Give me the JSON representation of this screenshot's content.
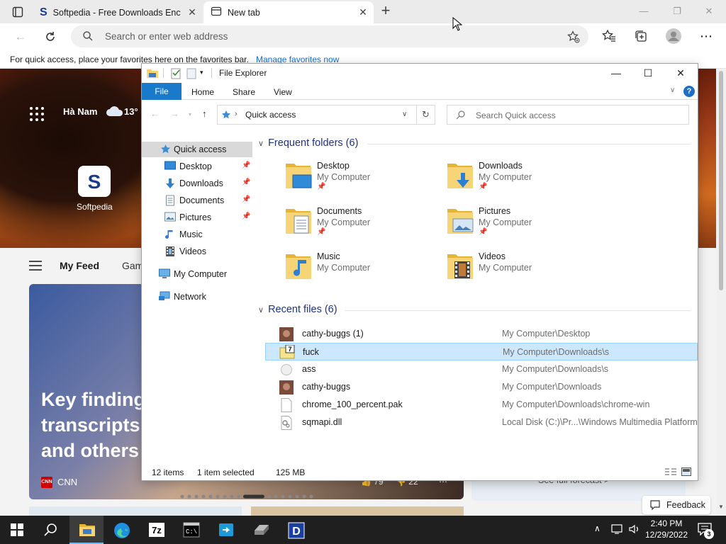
{
  "browser": {
    "tabs": [
      {
        "title": "Softpedia - Free Downloads Enc"
      },
      {
        "title": "New tab"
      }
    ],
    "address_placeholder": "Search or enter web address",
    "favbar_prompt": "For quick access, place your favorites here on the favorites bar.",
    "favbar_link": "Manage favorites now"
  },
  "newtab": {
    "location": "Hà Nam",
    "temperature": "13°",
    "tile_label": "Softpedia",
    "feed_tab": "My Feed",
    "feed_tab2": "Gam",
    "headline_lines": [
      "Key finding",
      "transcripts,",
      "and others"
    ],
    "source": "CNN",
    "source_logo": "CNN",
    "likes": "79",
    "dislikes": "22",
    "forecast_link": "See full forecast >",
    "feedback": "Feedback"
  },
  "explorer": {
    "title": "File Explorer",
    "ribbon_tabs": [
      "File",
      "Home",
      "Share",
      "View"
    ],
    "address_location": "Quick access",
    "search_placeholder": "Search Quick access",
    "nav": [
      {
        "label": "Quick access",
        "icon": "star-icon"
      },
      {
        "label": "Desktop",
        "icon": "desktop-icon",
        "pinned": true
      },
      {
        "label": "Downloads",
        "icon": "downloads-icon",
        "pinned": true
      },
      {
        "label": "Documents",
        "icon": "documents-icon",
        "pinned": true
      },
      {
        "label": "Pictures",
        "icon": "pictures-icon",
        "pinned": true
      },
      {
        "label": "Music",
        "icon": "music-icon"
      },
      {
        "label": "Videos",
        "icon": "videos-icon"
      },
      {
        "label": "My Computer",
        "icon": "computer-icon"
      },
      {
        "label": "Network",
        "icon": "network-icon"
      }
    ],
    "frequent_header": "Frequent folders (6)",
    "frequent": [
      {
        "name": "Desktop",
        "location": "My Computer",
        "overlay": "desktop",
        "pinned": true
      },
      {
        "name": "Downloads",
        "location": "My Computer",
        "overlay": "downloads",
        "pinned": true
      },
      {
        "name": "Documents",
        "location": "My Computer",
        "overlay": "documents",
        "pinned": true
      },
      {
        "name": "Pictures",
        "location": "My Computer",
        "overlay": "pictures",
        "pinned": true
      },
      {
        "name": "Music",
        "location": "My Computer",
        "overlay": "music",
        "pinned": false
      },
      {
        "name": "Videos",
        "location": "My Computer",
        "overlay": "videos",
        "pinned": false
      }
    ],
    "recent_header": "Recent files (6)",
    "recent": [
      {
        "name": "cathy-buggs (1)",
        "path": "My Computer\\Desktop",
        "icon": "photo-icon"
      },
      {
        "name": "fuck",
        "path": "My Computer\\Downloads\\s",
        "icon": "archive-7z-icon",
        "selected": true
      },
      {
        "name": "ass",
        "path": "My Computer\\Downloads\\s",
        "icon": "generic-file-icon"
      },
      {
        "name": "cathy-buggs",
        "path": "My Computer\\Downloads",
        "icon": "photo-icon"
      },
      {
        "name": "chrome_100_percent.pak",
        "path": "My Computer\\Downloads\\chrome-win",
        "icon": "blank-file-icon"
      },
      {
        "name": "sqmapi.dll",
        "path": "Local Disk (C:)\\Pr...\\Windows Multimedia Platform",
        "icon": "dll-file-icon"
      }
    ],
    "status": {
      "items": "12 items",
      "selected": "1 item selected",
      "size": "125 MB"
    }
  },
  "taskbar": {
    "apps": [
      "start-icon",
      "search-icon",
      "file-explorer-icon",
      "edge-icon",
      "7zip-icon",
      "cmd-icon",
      "app-icon",
      "drive-icon",
      "d-app-icon"
    ],
    "time": "2:40 PM",
    "date": "12/29/2022",
    "notifications": "3"
  },
  "colors": {
    "accent": "#1979ca",
    "selection": "#cce8ff",
    "taskbar": "#1f1f1f"
  }
}
